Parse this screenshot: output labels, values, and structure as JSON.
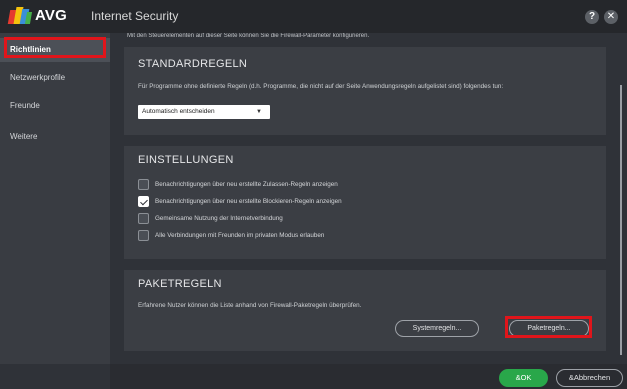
{
  "window": {
    "brand": "AVG",
    "product": "Internet Security",
    "help_label": "?",
    "close_label": "✕"
  },
  "sidebar": {
    "items": [
      {
        "label": "Richtlinien",
        "active": true
      },
      {
        "label": "Netzwerkprofile",
        "active": false
      },
      {
        "label": "Freunde",
        "active": false
      },
      {
        "label": "Weitere",
        "active": false
      }
    ]
  },
  "main": {
    "intro": "Mit den Steuerelementen auf dieser Seite können Sie die Firewall-Parameter konfigurieren.",
    "standard": {
      "title": "STANDARDREGELN",
      "text": "Für Programme ohne definierte Regeln (d.h. Programme, die nicht auf der Seite Anwendungsregeln aufgelistet sind) folgendes tun:",
      "select_value": "Automatisch entscheiden"
    },
    "settings": {
      "title": "EINSTELLUNGEN",
      "options": [
        {
          "label": "Benachrichtigungen über neu erstellte Zulassen-Regeln anzeigen",
          "checked": false
        },
        {
          "label": "Benachrichtigungen über neu erstellte Blockieren-Regeln anzeigen",
          "checked": true
        },
        {
          "label": "Gemeinsame Nutzung der Internetverbindung",
          "checked": false
        },
        {
          "label": "Alle Verbindungen mit Freunden im privaten Modus erlauben",
          "checked": false
        }
      ]
    },
    "packets": {
      "title": "PAKETREGELN",
      "text": "Erfahrene Nutzer können die Liste anhand von Firewall-Paketregeln überprüfen.",
      "system_button": "Systemregeln...",
      "packet_button": "Paketregeln..."
    }
  },
  "footer": {
    "ok_label": "&OK",
    "cancel_label": "&Abbrechen"
  },
  "colors": {
    "accent_ok": "#29a74a",
    "highlight": "#e0151b",
    "background": "#2f3238",
    "panel": "#3b3e44"
  }
}
